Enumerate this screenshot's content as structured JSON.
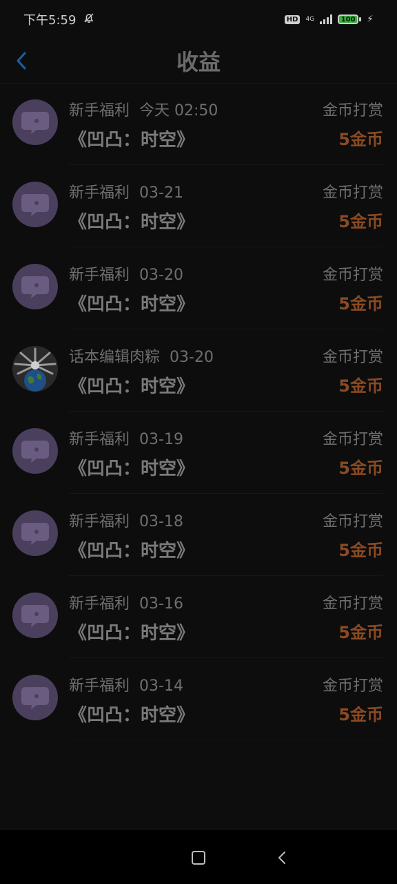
{
  "status": {
    "time": "下午5:59",
    "hd": "HD",
    "network": "4G",
    "battery": "100"
  },
  "header": {
    "title": "收益"
  },
  "colors": {
    "amount": "#8a4a22",
    "avatar_bg": "#4b3f5e",
    "back_arrow": "#1f5f9e"
  },
  "records": [
    {
      "source": "新手福利",
      "date": "今天 02:50",
      "book": "《凹凸：时空》",
      "type": "金币打赏",
      "amount": "5金币",
      "avatar": "chat-bubble-icon"
    },
    {
      "source": "新手福利",
      "date": "03-21",
      "book": "《凹凸：时空》",
      "type": "金币打赏",
      "amount": "5金币",
      "avatar": "chat-bubble-icon"
    },
    {
      "source": "新手福利",
      "date": "03-20",
      "book": "《凹凸：时空》",
      "type": "金币打赏",
      "amount": "5金币",
      "avatar": "chat-bubble-icon"
    },
    {
      "source": "话本编辑肉粽",
      "date": "03-20",
      "book": "《凹凸：时空》",
      "type": "金币打赏",
      "amount": "5金币",
      "avatar": "earth-avatar"
    },
    {
      "source": "新手福利",
      "date": "03-19",
      "book": "《凹凸：时空》",
      "type": "金币打赏",
      "amount": "5金币",
      "avatar": "chat-bubble-icon"
    },
    {
      "source": "新手福利",
      "date": "03-18",
      "book": "《凹凸：时空》",
      "type": "金币打赏",
      "amount": "5金币",
      "avatar": "chat-bubble-icon"
    },
    {
      "source": "新手福利",
      "date": "03-16",
      "book": "《凹凸：时空》",
      "type": "金币打赏",
      "amount": "5金币",
      "avatar": "chat-bubble-icon"
    },
    {
      "source": "新手福利",
      "date": "03-14",
      "book": "《凹凸：时空》",
      "type": "金币打赏",
      "amount": "5金币",
      "avatar": "chat-bubble-icon"
    }
  ]
}
